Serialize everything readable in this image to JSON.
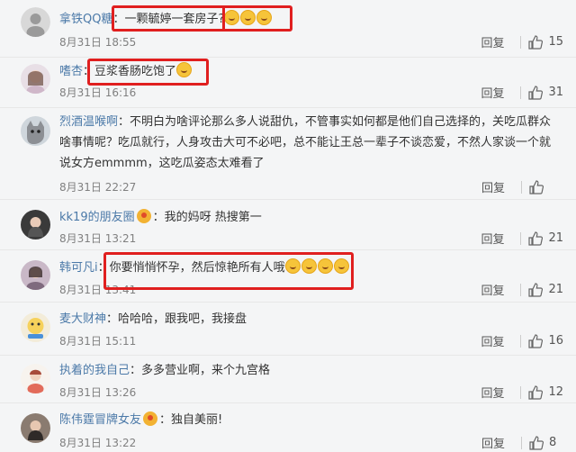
{
  "labels": {
    "reply": "回复"
  },
  "colors": {
    "highlight": "#e01f1f",
    "name": "#4b79a8"
  },
  "comments": [
    {
      "name": "拿铁QQ糖",
      "text": "一颗毓婷一套房子?",
      "time": "8月31日 18:55",
      "likes": "15",
      "avatar_icon": "blurred-avatar-icon"
    },
    {
      "name": "嗜杏",
      "text": "豆浆香肠吃饱了",
      "time": "8月31日 16:16",
      "likes": "31",
      "avatar_icon": "girl-avatar-icon"
    },
    {
      "name": "烈酒温喉啊",
      "text": "不明白为啥评论那么多人说甜仇，不管事实如何都是他们自己选择的，关吃瓜群众啥事情呢？吃瓜就行，人身攻击大可不必吧，总不能让王总一辈子不谈恋爱，不然人家谈一个就说女方emmmm，这吃瓜姿态太难看了",
      "time": "8月31日 22:27",
      "likes": "",
      "avatar_icon": "cat-avatar-icon"
    },
    {
      "name": "kk19的朋友圈",
      "text": "我的妈呀 热搜第一",
      "time": "8月31日 13:21",
      "likes": "21",
      "avatar_icon": "woman-avatar-icon"
    },
    {
      "name": "韩可凡i",
      "text": "你要悄悄怀孕，然后惊艳所有人哦",
      "time": "8月31日 13:41",
      "likes": "21",
      "avatar_icon": "woman-avatar-icon"
    },
    {
      "name": "麦大财神",
      "text": "哈哈哈，跟我吧，我接盘",
      "time": "8月31日 15:11",
      "likes": "16",
      "avatar_icon": "cartoon-avatar-icon"
    },
    {
      "name": "执着的我自己",
      "text": "多多营业啊，来个九宫格",
      "time": "8月31日 13:26",
      "likes": "12",
      "avatar_icon": "cartoon-avatar-icon"
    },
    {
      "name": "陈伟霆冒牌女友",
      "text": "独自美丽!",
      "time": "8月31日 13:22",
      "likes": "8",
      "avatar_icon": "woman-avatar-icon"
    }
  ]
}
